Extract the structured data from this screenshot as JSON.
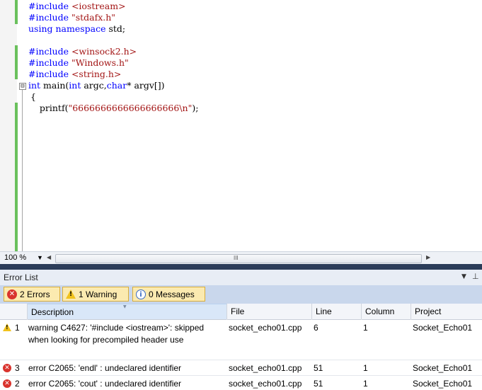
{
  "editor": {
    "lines": [
      [
        {
          "t": "#include ",
          "c": "kw"
        },
        {
          "t": "<iostream>",
          "c": "str"
        }
      ],
      [
        {
          "t": "#include ",
          "c": "kw"
        },
        {
          "t": "\"stdafx.h\"",
          "c": "str"
        }
      ],
      [
        {
          "t": "using namespace ",
          "c": "kw"
        },
        {
          "t": "std;",
          "c": ""
        }
      ],
      [],
      [
        {
          "t": "#include ",
          "c": "kw"
        },
        {
          "t": "<winsock2.h>",
          "c": "str"
        }
      ],
      [
        {
          "t": "#include ",
          "c": "kw"
        },
        {
          "t": "\"Windows.h\"",
          "c": "str"
        }
      ],
      [
        {
          "t": "#include ",
          "c": "kw"
        },
        {
          "t": "<string.h>",
          "c": "str"
        }
      ],
      [
        {
          "t": "int ",
          "c": "kw"
        },
        {
          "t": "main(",
          "c": ""
        },
        {
          "t": "int ",
          "c": "kw"
        },
        {
          "t": "argc,",
          "c": ""
        },
        {
          "t": "char",
          "c": "kw"
        },
        {
          "t": "* argv[])",
          "c": ""
        }
      ],
      [
        {
          "t": "{",
          "c": ""
        }
      ],
      [
        {
          "t": "    printf(",
          "c": ""
        },
        {
          "t": "\"6666666666666666666\\n\"",
          "c": "str"
        },
        {
          "t": ");",
          "c": ""
        }
      ]
    ],
    "fold_symbol": "⊟",
    "zoom": "100 %",
    "scroll_grip": "III"
  },
  "error_list": {
    "title": "Error List",
    "filters": {
      "errors": "2 Errors",
      "warnings": "1 Warning",
      "messages": "0 Messages"
    },
    "columns": [
      "Description",
      "File",
      "Line",
      "Column",
      "Project"
    ],
    "rows": [
      {
        "type": "warning",
        "num": "1",
        "description": "warning C4627: '#include <iostream>': skipped when looking for precompiled header use",
        "file": "socket_echo01.cpp",
        "line": "6",
        "column": "1",
        "project": "Socket_Echo01"
      },
      {
        "type": "error",
        "num": "3",
        "description": "error C2065: 'endl' : undeclared identifier",
        "file": "socket_echo01.cpp",
        "line": "51",
        "column": "1",
        "project": "Socket_Echo01"
      },
      {
        "type": "error",
        "num": "2",
        "description": "error C2065: 'cout' : undeclared identifier",
        "file": "socket_echo01.cpp",
        "line": "51",
        "column": "1",
        "project": "Socket_Echo01"
      }
    ]
  },
  "colors": {
    "keyword": "#0000ff",
    "string": "#a31515",
    "change_bar": "#6ac05c",
    "error": "#d9332d",
    "warning": "#f1c21d"
  }
}
